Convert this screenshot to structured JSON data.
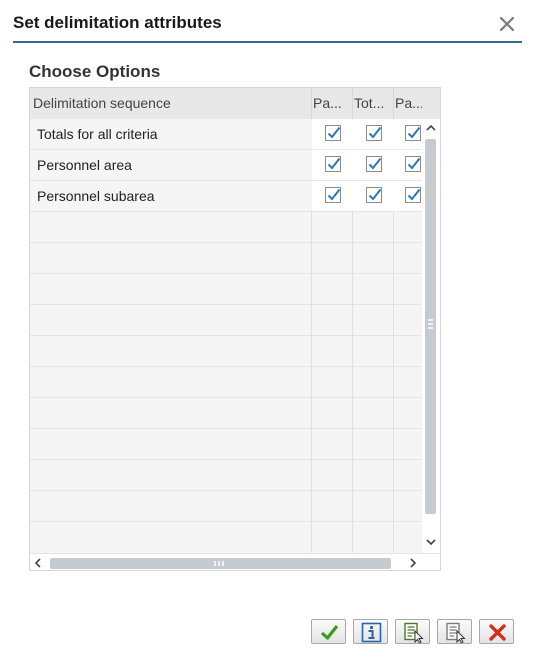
{
  "dialog": {
    "title": "Set delimitation attributes",
    "close_icon": "close-icon"
  },
  "section": {
    "title": "Choose Options"
  },
  "table": {
    "columns": [
      "Delimitation sequence",
      "Pa...",
      "Tot...",
      "Pa..."
    ],
    "rows": [
      {
        "label": "Totals for all criteria",
        "checks": [
          true,
          true,
          true
        ]
      },
      {
        "label": "Personnel area",
        "checks": [
          true,
          true,
          true
        ]
      },
      {
        "label": "Personnel subarea",
        "checks": [
          true,
          true,
          true
        ]
      }
    ]
  },
  "footer": {
    "buttons": [
      {
        "name": "confirm-button",
        "icon": "checkmark-icon"
      },
      {
        "name": "info-button",
        "icon": "info-icon"
      },
      {
        "name": "select-all-button",
        "icon": "select-all-icon"
      },
      {
        "name": "deselect-all-button",
        "icon": "deselect-all-icon"
      },
      {
        "name": "cancel-button",
        "icon": "cancel-icon"
      }
    ]
  },
  "colors": {
    "accent": "#2f6c96",
    "check": "#2a7ab8",
    "confirm": "#3c9a1f",
    "cancel": "#d0301c"
  }
}
